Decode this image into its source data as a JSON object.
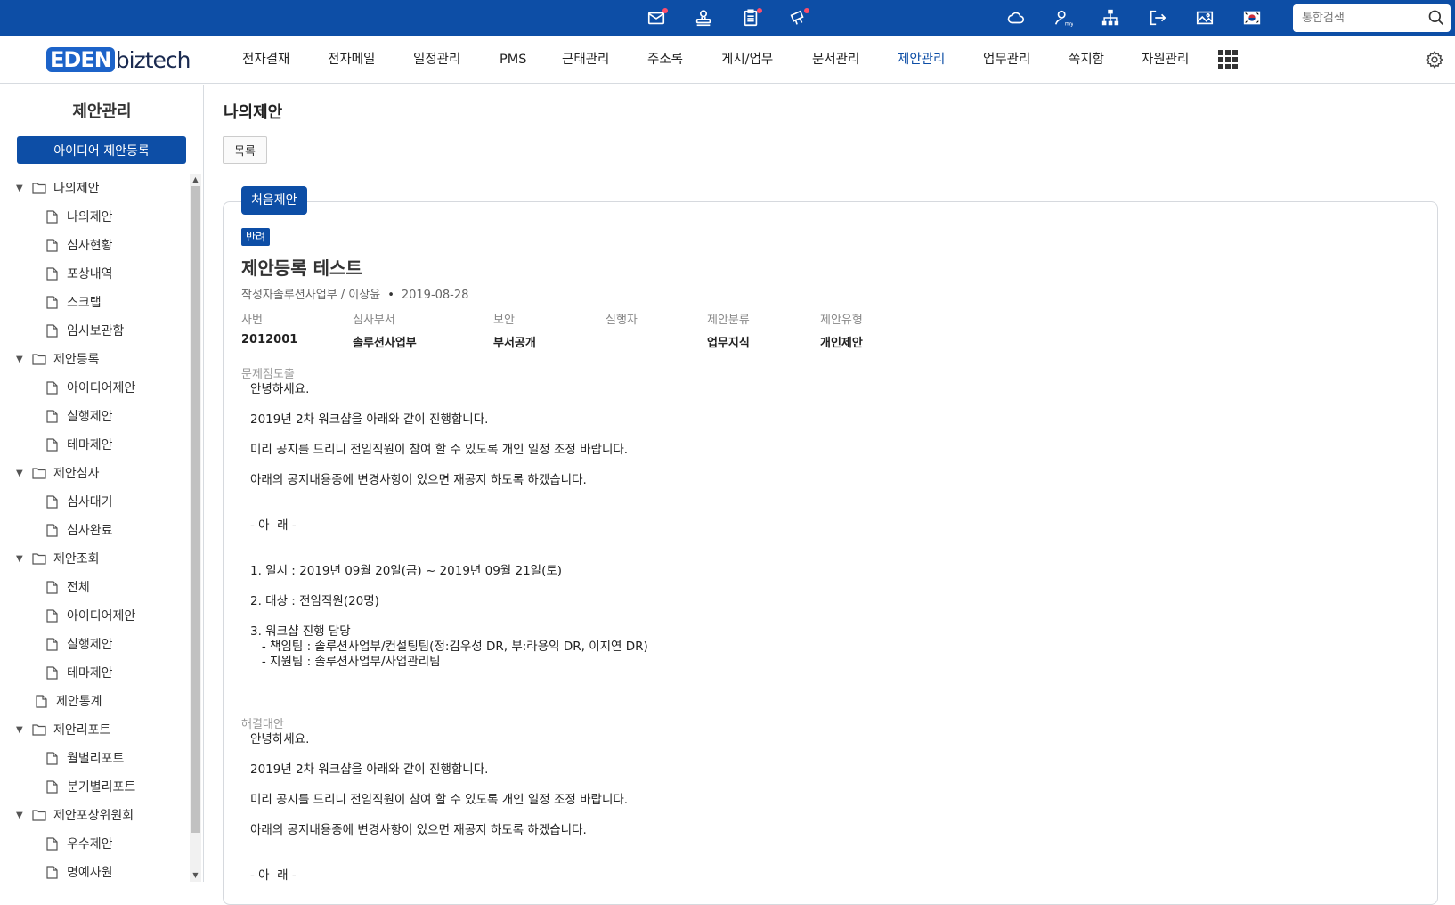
{
  "topbar": {
    "search_placeholder": "통합검색",
    "icons": [
      "mail-icon",
      "approval-icon",
      "clipboard-icon",
      "gift-icon",
      "cloud-icon",
      "my-user-icon",
      "org-chart-icon",
      "logout-icon",
      "photo-icon",
      "korea-flag-icon",
      "search-icon"
    ]
  },
  "logo": {
    "part1": "EDEN",
    "part2": "biztech"
  },
  "menu": [
    {
      "label": "전자결재"
    },
    {
      "label": "전자메일"
    },
    {
      "label": "일정관리"
    },
    {
      "label": "PMS"
    },
    {
      "label": "근태관리"
    },
    {
      "label": "주소록"
    },
    {
      "label": "게시/업무"
    },
    {
      "label": "문서관리"
    },
    {
      "label": "제안관리"
    },
    {
      "label": "업무관리"
    },
    {
      "label": "쪽지함"
    },
    {
      "label": "자원관리"
    }
  ],
  "sidebar": {
    "title": "제안관리",
    "register_button": "아이디어 제안등록",
    "tree": [
      {
        "type": "folder",
        "label": "나의제안"
      },
      {
        "type": "child",
        "label": "나의제안"
      },
      {
        "type": "child",
        "label": "심사현황"
      },
      {
        "type": "child",
        "label": "포상내역"
      },
      {
        "type": "child",
        "label": "스크랩"
      },
      {
        "type": "child",
        "label": "임시보관함"
      },
      {
        "type": "folder",
        "label": "제안등록"
      },
      {
        "type": "child",
        "label": "아이디어제안"
      },
      {
        "type": "child",
        "label": "실행제안"
      },
      {
        "type": "child",
        "label": "테마제안"
      },
      {
        "type": "folder",
        "label": "제안심사"
      },
      {
        "type": "child",
        "label": "심사대기"
      },
      {
        "type": "child",
        "label": "심사완료"
      },
      {
        "type": "folder",
        "label": "제안조회"
      },
      {
        "type": "child",
        "label": "전체"
      },
      {
        "type": "child",
        "label": "아이디어제안"
      },
      {
        "type": "child",
        "label": "실행제안"
      },
      {
        "type": "child",
        "label": "테마제안"
      },
      {
        "type": "leaf",
        "label": "제안통계"
      },
      {
        "type": "folder",
        "label": "제안리포트"
      },
      {
        "type": "child",
        "label": "월별리포트"
      },
      {
        "type": "child",
        "label": "분기별리포트"
      },
      {
        "type": "folder",
        "label": "제안포상위원회"
      },
      {
        "type": "child",
        "label": "우수제안"
      },
      {
        "type": "child",
        "label": "명예사원"
      }
    ]
  },
  "main": {
    "page_title": "나의제안",
    "list_button": "목록",
    "tab": "처음제안",
    "status": "반려",
    "title": "제안등록 테스트",
    "author_label": "작성자",
    "author": "솔루션사업부 / 이상윤",
    "bullet": "•",
    "date": "2019-08-28",
    "fields": [
      {
        "label": "사번",
        "value": "2012001"
      },
      {
        "label": "심사부서",
        "value": "솔루션사업부"
      },
      {
        "label": "보안",
        "value": "부서공개"
      },
      {
        "label": "실행자",
        "value": ""
      },
      {
        "label": "제안분류",
        "value": "업무지식"
      },
      {
        "label": "제안유형",
        "value": "개인제안"
      }
    ],
    "problem_label": "문제점도출",
    "solution_label": "해결대안",
    "problem_lines": [
      "안녕하세요.",
      "2019년 2차 워크샵을 아래와 같이 진행합니다.",
      "미리 공지를 드리니 전임직원이 참여 할 수 있도록 개인 일정 조정 바랍니다.",
      "아래의 공지내용중에 변경사항이 있으면 재공지 하도록 하겠습니다.",
      "- 아  래 -",
      "1. 일시 : 2019년 09월 20일(금) ~ 2019년 09월 21일(토)",
      "2. 대상 : 전임직원(20명)",
      "3. 워크샵 진행 담당",
      "   - 책임팀 : 솔루션사업부/컨설팅팀(정:김우성 DR, 부:라용익 DR, 이지연 DR)",
      "   - 지원팀 : 솔루션사업부/사업관리팀"
    ],
    "solution_lines": [
      "안녕하세요.",
      "2019년 2차 워크샵을 아래와 같이 진행합니다.",
      "미리 공지를 드리니 전임직원이 참여 할 수 있도록 개인 일정 조정 바랍니다.",
      "아래의 공지내용중에 변경사항이 있으면 재공지 하도록 하겠습니다.",
      "- 아  래 -"
    ]
  }
}
